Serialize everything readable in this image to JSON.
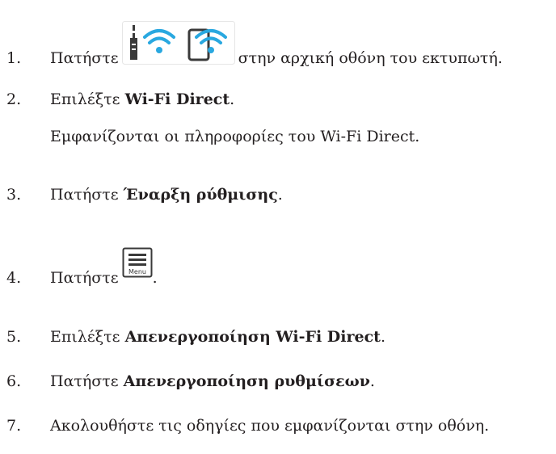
{
  "steps": [
    {
      "num": "1.",
      "pre": "Πατήστε",
      "post": "στην αρχική οθόνη του εκτυπωτή."
    },
    {
      "num": "2.",
      "pre": "Επιλέξτε ",
      "bold": "Wi-Fi Direct",
      "post": ".",
      "note": "Εμφανίζονται οι πληροφορίες του Wi-Fi Direct."
    },
    {
      "num": "3.",
      "pre": "Πατήστε ",
      "bold": "Έναρξη ρύθμισης",
      "post": "."
    },
    {
      "num": "4.",
      "pre": "Πατήστε",
      "post": "."
    },
    {
      "num": "5.",
      "pre": "Επιλέξτε ",
      "bold": "Απενεργοποίηση Wi-Fi Direct",
      "post": "."
    },
    {
      "num": "6.",
      "pre": "Πατήστε ",
      "bold": "Απενεργοποίηση ρυθμίσεων",
      "post": "."
    },
    {
      "num": "7.",
      "pre": "Ακολουθήστε τις οδηγίες που εμφανίζονται στην οθόνη."
    }
  ],
  "icons": {
    "wifi_button": "wifi-status-button-icon",
    "menu_button": "menu-button-icon",
    "menu_label": "Menu"
  },
  "colors": {
    "text": "#231f20",
    "wifi_blue": "#29a8e0",
    "icon_dark": "#3a3a3a"
  }
}
